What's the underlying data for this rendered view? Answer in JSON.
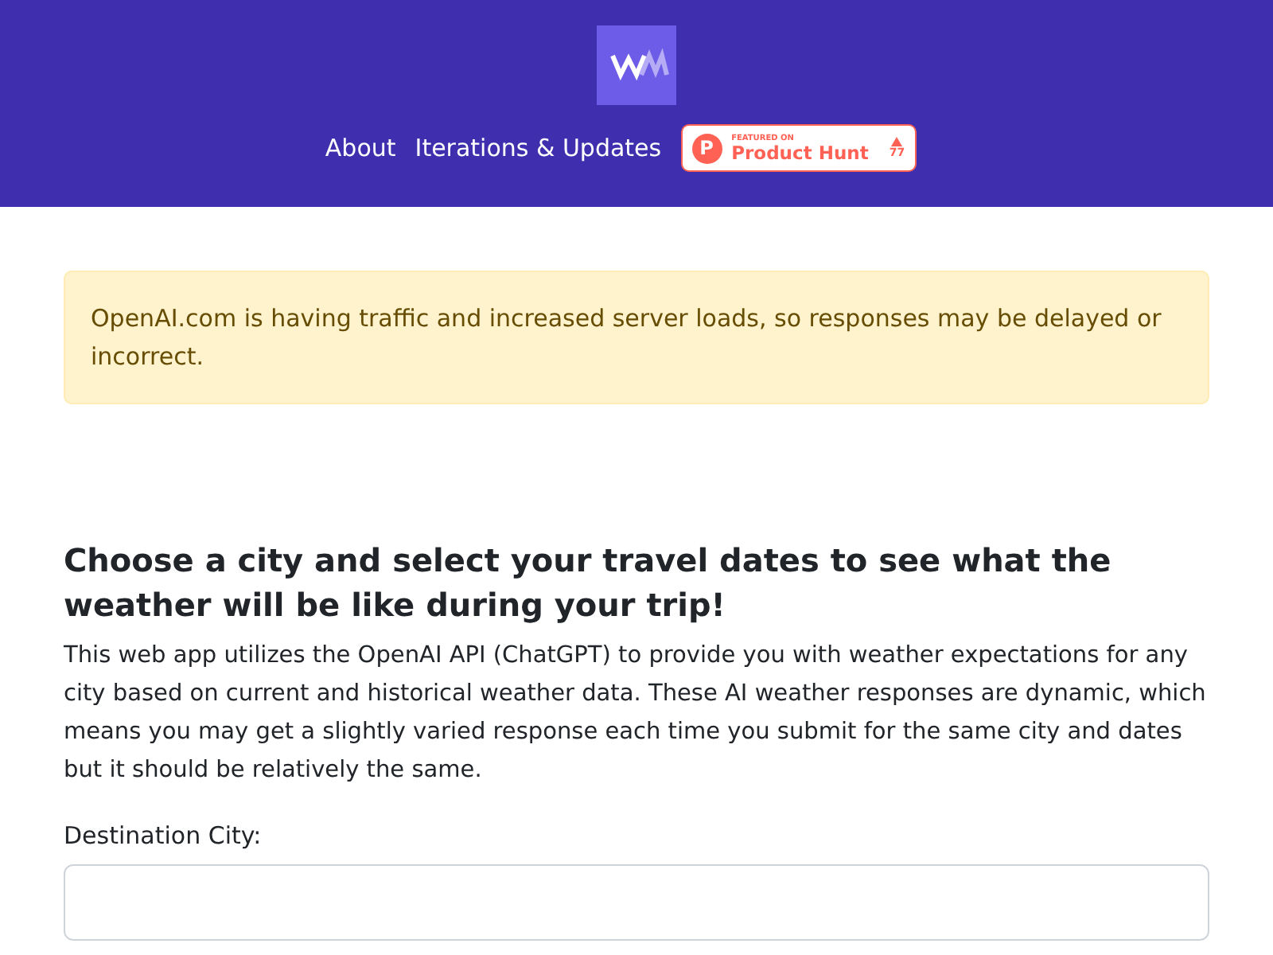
{
  "header": {
    "nav": [
      "About",
      "Iterations & Updates"
    ],
    "badge": {
      "featured": "FEATURED ON",
      "name": "Product Hunt",
      "count": "77",
      "letter": "P"
    }
  },
  "alert": {
    "text": "OpenAI.com is having traffic and increased server loads, so responses may be delayed or incorrect."
  },
  "main": {
    "heading": "Choose a city and select your travel dates to see what the weather will be like during your trip!",
    "description": "This web app utilizes the OpenAI API (ChatGPT) to provide you with weather expectations for any city based on current and historical weather data. These AI weather responses are dynamic, which means you may get a slightly varied response each time you submit for the same city and dates but it should be relatively the same.",
    "field_label": "Destination City:"
  }
}
